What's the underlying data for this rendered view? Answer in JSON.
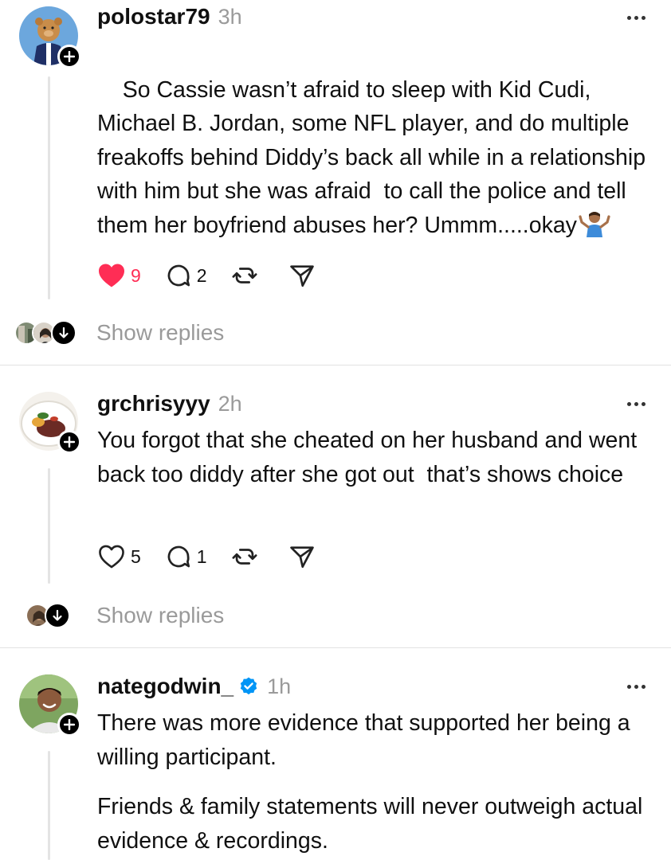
{
  "posts": [
    {
      "username": "polostar79",
      "time": "3h",
      "verified": false,
      "text": "So Cassie wasn’t afraid to sleep with Kid Cudi, Michael B. Jordan, some NFL player, and do multiple freakoffs behind Diddy’s back all while in a relationship with him but she was afraid  to call the police and tell them her boyfriend abuses her? Ummm.....okay",
      "emoji": "person-shrugging",
      "likes": "9",
      "liked": true,
      "replies": "2",
      "show_replies": "Show replies"
    },
    {
      "username": "grchrisyyy",
      "time": "2h",
      "verified": false,
      "text": "You forgot that she cheated on her husband and went back too diddy after she got out  that’s shows choice",
      "likes": "5",
      "liked": false,
      "replies": "1",
      "show_replies": "Show replies"
    },
    {
      "username": "nategodwin_",
      "time": "1h",
      "verified": true,
      "text_p1": "There was more evidence that supported her being a willing participant.",
      "text_p2": "Friends & family statements will never outweigh actual evidence & recordings."
    }
  ],
  "colors": {
    "like_red": "#ff2d55",
    "verified_blue": "#0095f6",
    "muted": "#9a9a9a"
  }
}
